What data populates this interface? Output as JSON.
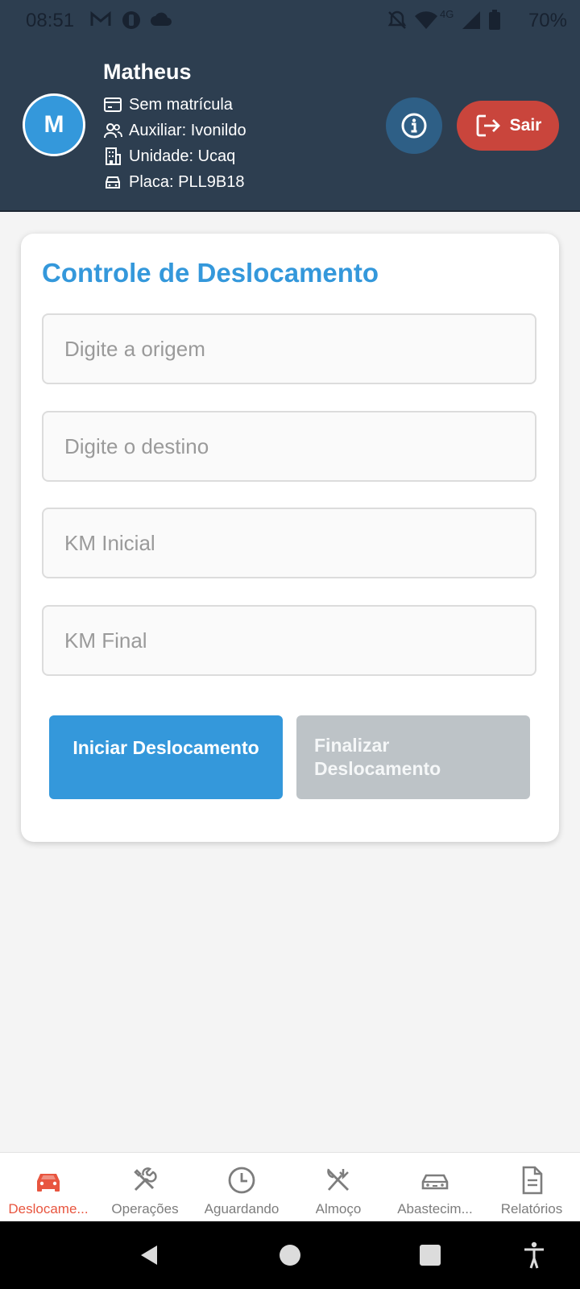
{
  "status_bar": {
    "time": "08:51",
    "battery": "70%",
    "network": "4G",
    "icons": [
      "gmail-icon",
      "app-notification-icon",
      "cloud-icon",
      "alarm-off-icon",
      "wifi-icon",
      "signal-icon",
      "battery-icon"
    ]
  },
  "header": {
    "avatar_initial": "M",
    "user_name": "Matheus",
    "registration": "Sem matrícula",
    "assistant": "Auxiliar: Ivonildo",
    "unit": "Unidade: Ucaq",
    "plate": "Placa: PLL9B18",
    "logout_label": "Sair",
    "colors": {
      "background": "#2d3e50",
      "avatar": "#3498db",
      "info_button": "#2e5f86",
      "logout_button": "#c9453c"
    }
  },
  "form": {
    "title": "Controle de Deslocamento",
    "origin_placeholder": "Digite a origem",
    "destination_placeholder": "Digite o destino",
    "km_start_placeholder": "KM Inicial",
    "km_end_placeholder": "KM Final",
    "start_button": "Iniciar Deslocamento",
    "finish_button": "Finalizar Deslocamento",
    "colors": {
      "title": "#3498db",
      "start_button": "#3498db",
      "finish_button_disabled": "#bdc3c7"
    }
  },
  "tabs": [
    {
      "label": "Deslocame...",
      "icon": "car-icon",
      "active": true
    },
    {
      "label": "Operações",
      "icon": "tools-icon",
      "active": false
    },
    {
      "label": "Aguardando",
      "icon": "clock-icon",
      "active": false
    },
    {
      "label": "Almoço",
      "icon": "utensils-icon",
      "active": false
    },
    {
      "label": "Abastecim...",
      "icon": "car-outline-icon",
      "active": false
    },
    {
      "label": "Relatórios",
      "icon": "document-icon",
      "active": false
    }
  ],
  "tab_colors": {
    "active": "#e8553f",
    "inactive": "#7d7d7d"
  },
  "navigation_bar": [
    "back-icon",
    "home-icon",
    "recents-icon",
    "accessibility-icon"
  ]
}
